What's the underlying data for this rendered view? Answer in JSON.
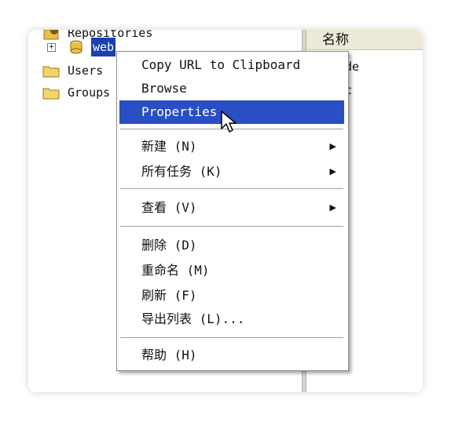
{
  "tree": {
    "items": [
      {
        "label": "Repositories"
      },
      {
        "label": "web",
        "selected": true
      },
      {
        "label": "Users"
      },
      {
        "label": "Groups"
      }
    ]
  },
  "right_pane": {
    "column_header": "名称",
    "items": [
      "ode",
      "oc"
    ]
  },
  "context_menu": {
    "items": [
      {
        "label": "Copy URL to Clipboard"
      },
      {
        "label": "Browse"
      },
      {
        "label": "Properties",
        "highlighted": true
      },
      {
        "label": "新建 (N)",
        "submenu": true
      },
      {
        "label": "所有任务 (K)",
        "submenu": true
      },
      {
        "label": "查看 (V)",
        "submenu": true
      },
      {
        "label": "删除 (D)"
      },
      {
        "label": "重命名 (M)"
      },
      {
        "label": "刷新 (F)"
      },
      {
        "label": "导出列表 (L)..."
      },
      {
        "label": "帮助 (H)"
      }
    ]
  },
  "icons": [
    "repository-icon",
    "database-icon",
    "folder-icon",
    "submenu-arrow-icon",
    "mouse-cursor-icon"
  ],
  "colors": {
    "selection": "#1b3fb3",
    "menu_highlight": "#2a4fc4",
    "header": "#ece9d8"
  }
}
